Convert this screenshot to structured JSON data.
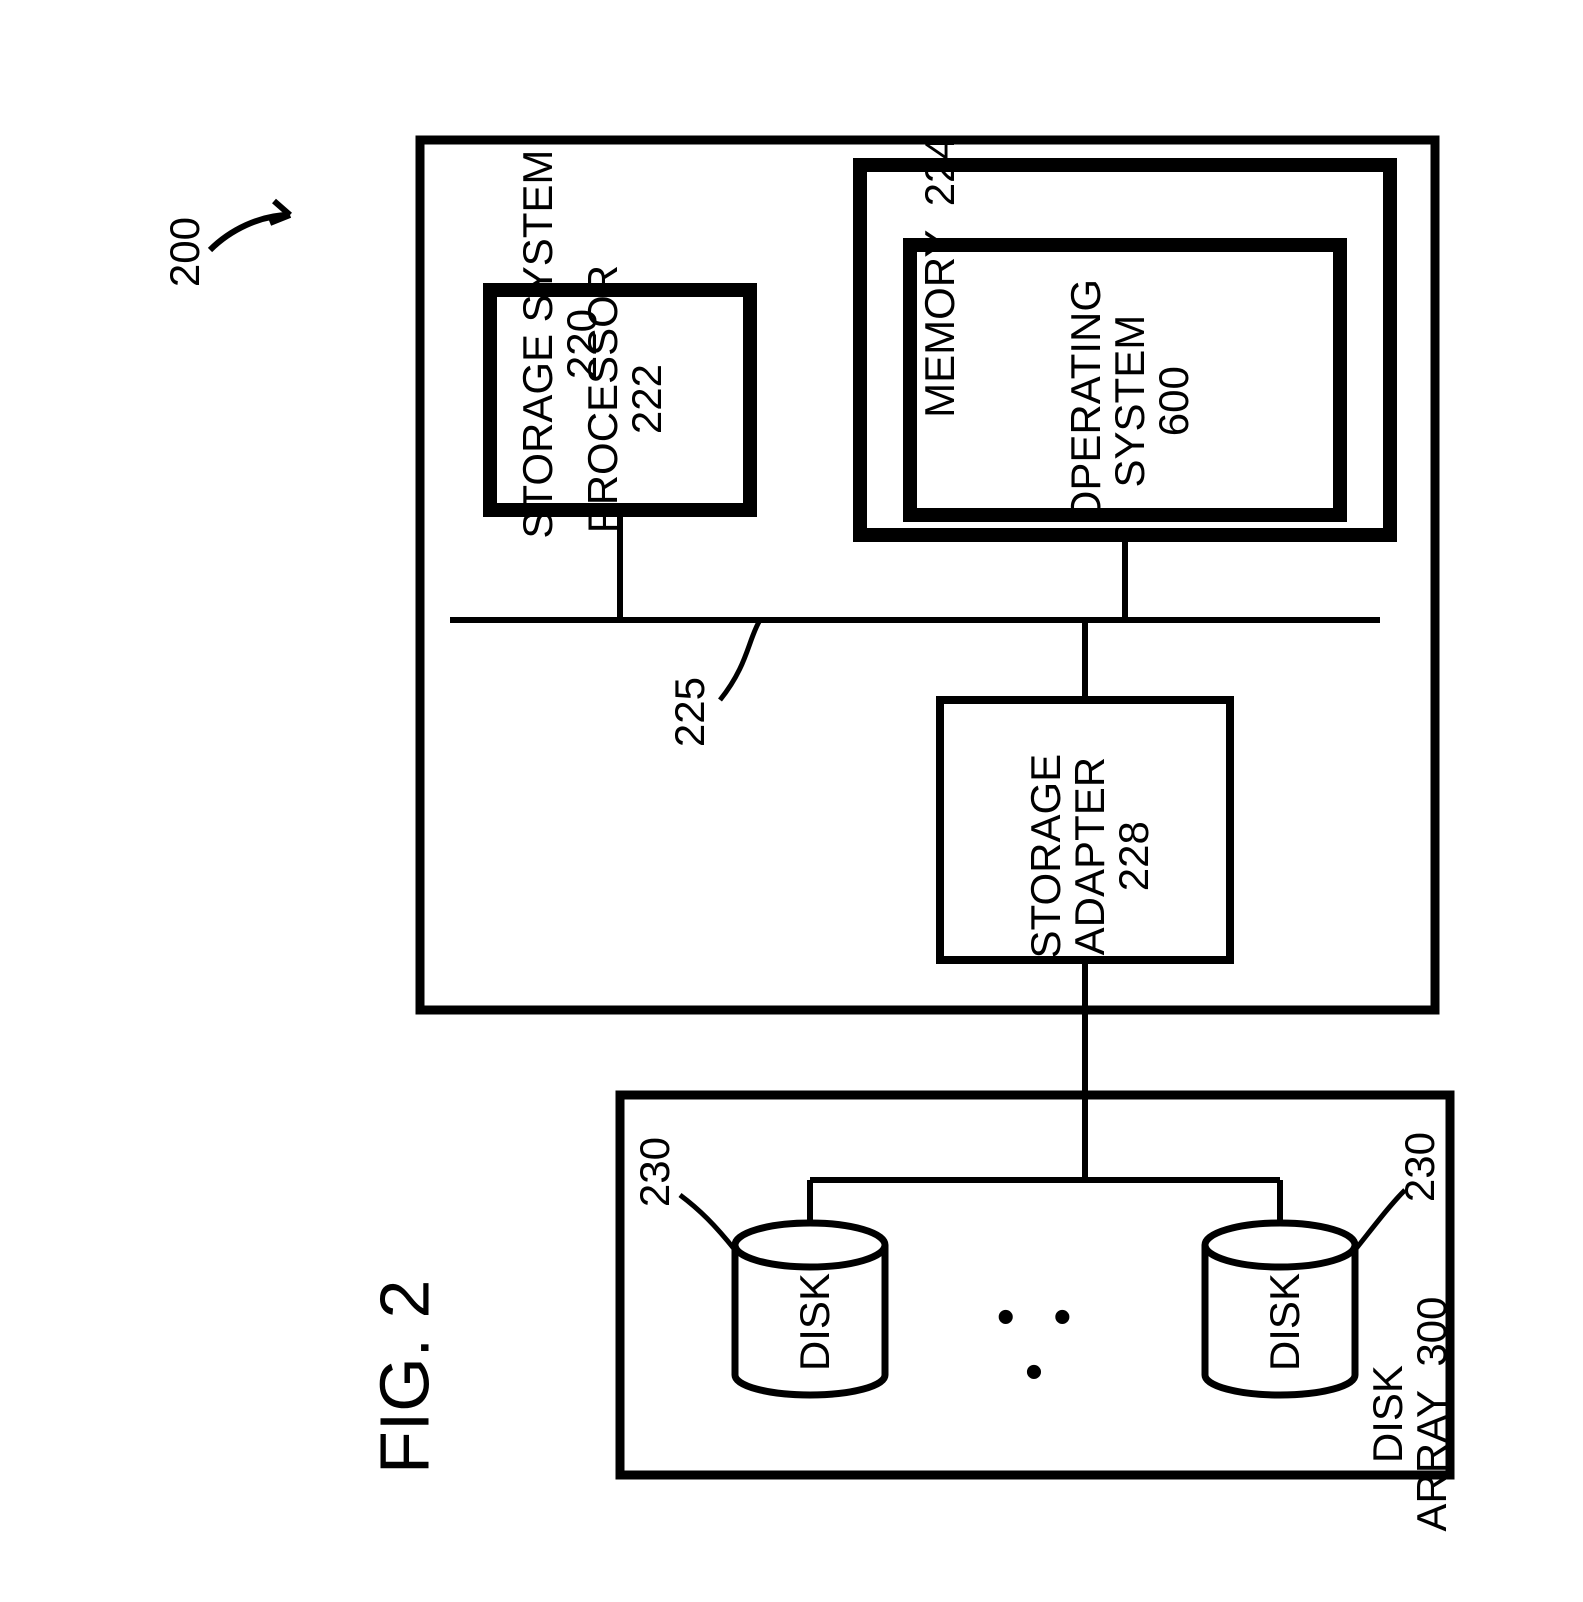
{
  "figure_ref": "200",
  "figure_caption": "FIG. 2",
  "storage_system": {
    "title": "STORAGE SYSTEM",
    "ref": "220",
    "processor": {
      "label": "PROCESSOR",
      "ref": "222"
    },
    "memory": {
      "label": "MEMORY",
      "ref": "224",
      "os": {
        "label": "OPERATING\nSYSTEM",
        "ref": "600"
      }
    },
    "bus_ref": "225",
    "adapter": {
      "label": "STORAGE\nADAPTER",
      "ref": "228"
    }
  },
  "disk_array": {
    "title": "DISK ARRAY",
    "ref": "300",
    "disk_label": "DISK",
    "disk_ref_left": "230",
    "disk_ref_right": "230",
    "ellipsis": "• • •"
  }
}
